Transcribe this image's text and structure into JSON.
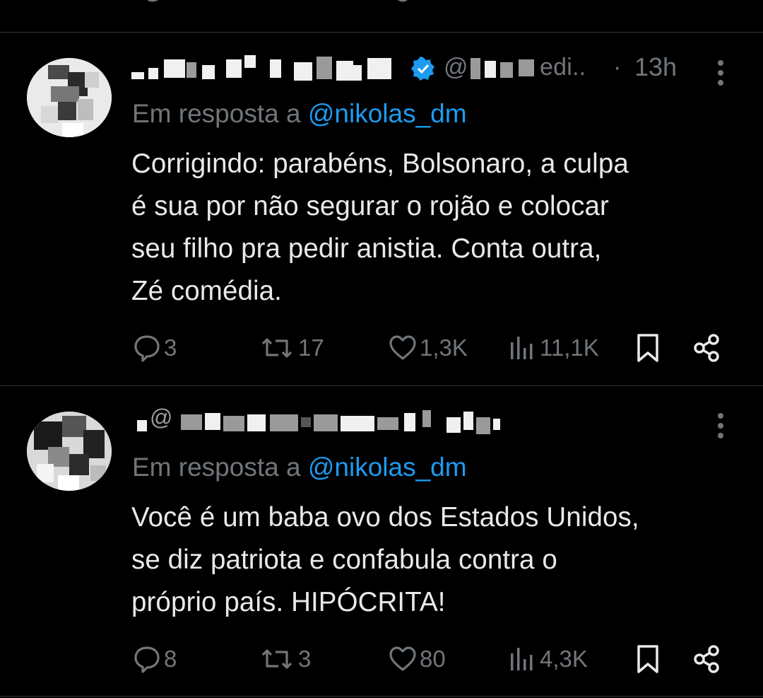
{
  "tweets": [
    {
      "time": "13h",
      "handle_fragment": "@",
      "handle_tail": "edi..",
      "reply_prefix": "Em resposta a",
      "reply_mention": "@nikolas_dm",
      "text": "Corrigindo: parabéns, Bolsonaro, a culpa\né sua por não segurar o rojão e colocar\nseu filho pra pedir anistia. Conta outra,\nZé comédia.",
      "replies": "3",
      "reposts": "17",
      "likes": "1,3K",
      "views": "11,1K"
    },
    {
      "handle_fragment": "@",
      "reply_prefix": "Em resposta a",
      "reply_mention": "@nikolas_dm",
      "text": "Você é um baba ovo dos Estados Unidos,\nse diz patriota e confabula contra o\npróprio país. HIPÓCRITA!",
      "replies": "8",
      "reposts": "3",
      "likes": "80",
      "views": "4,3K"
    }
  ],
  "colors": {
    "background": "#000000",
    "text": "#e7e9ea",
    "muted": "#71767b",
    "accent": "#1d9bf0",
    "divider": "#2f3336"
  },
  "icons": [
    "reply-icon",
    "repost-icon",
    "like-icon",
    "views-icon",
    "bookmark-icon",
    "share-icon",
    "more-icon",
    "verified-badge-icon"
  ]
}
